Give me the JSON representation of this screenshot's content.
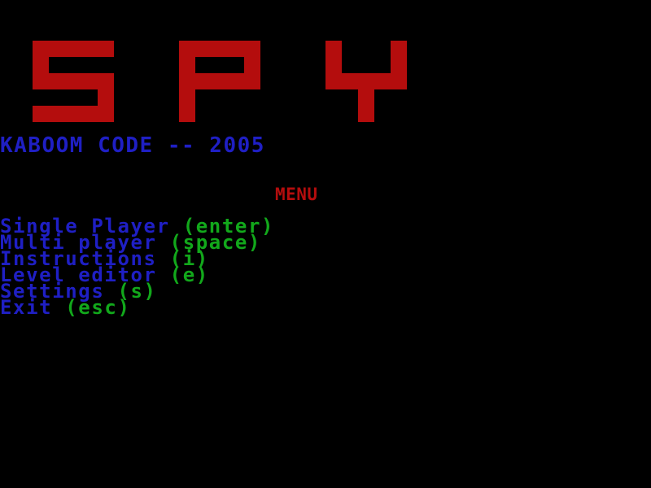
{
  "game": {
    "logo_text": "SPY",
    "subtitle": "KABOOM CODE -- 2005",
    "menu_heading": "MENU"
  },
  "menu": {
    "items": [
      {
        "label": "Single Player ",
        "key": "(enter)"
      },
      {
        "label": "Multi player ",
        "key": "(space)"
      },
      {
        "label": "Instructions ",
        "key": "(i)"
      },
      {
        "label": "Level editor ",
        "key": "(e)"
      },
      {
        "label": "Settings ",
        "key": "(s)"
      },
      {
        "label": "Exit ",
        "key": "(esc)"
      }
    ]
  },
  "colors": {
    "background": "#000000",
    "logo_red": "#b40d0d",
    "heading_red": "#b40d0d",
    "text_blue": "#1f1fc4",
    "key_green": "#12a81b"
  }
}
